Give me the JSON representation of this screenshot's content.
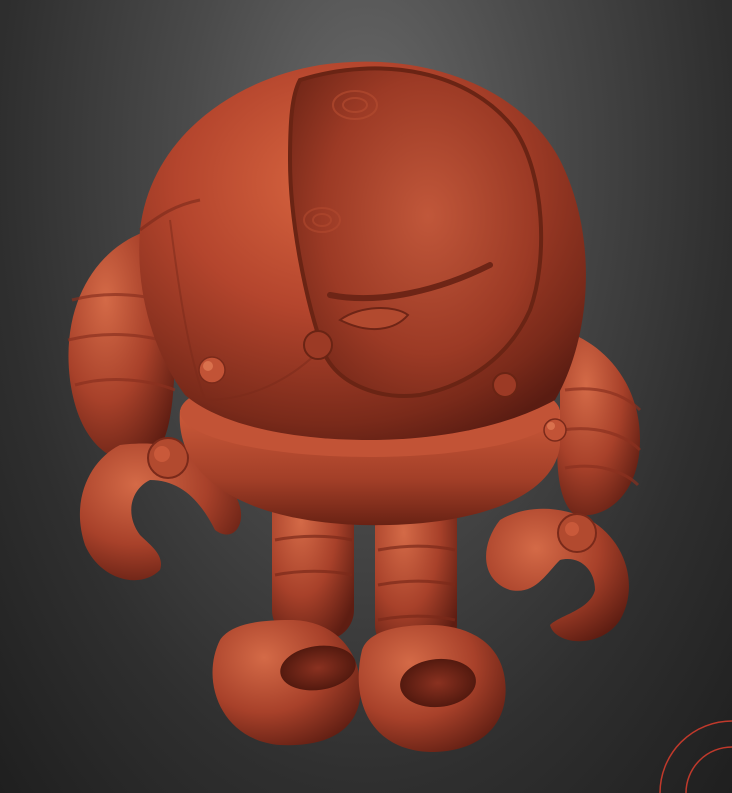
{
  "scene": {
    "subject": "robot-sculpt",
    "material_color": "#b4452d",
    "background_color": "#3c3c3c",
    "gizmo_color": "#c0392b"
  }
}
